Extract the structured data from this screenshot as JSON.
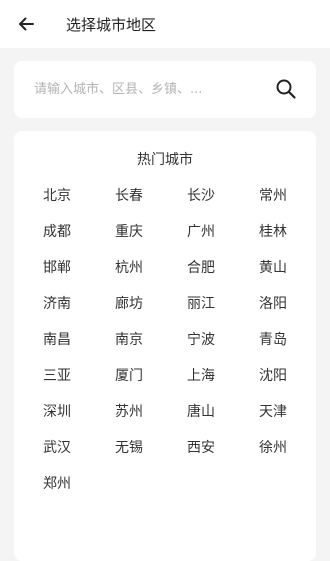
{
  "header": {
    "title": "选择城市地区"
  },
  "search": {
    "placeholder": "请输入城市、区县、乡镇、..."
  },
  "hot_cities": {
    "title": "热门城市",
    "cities": [
      "北京",
      "长春",
      "长沙",
      "常州",
      "成都",
      "重庆",
      "广州",
      "桂林",
      "邯郸",
      "杭州",
      "合肥",
      "黄山",
      "济南",
      "廊坊",
      "丽江",
      "洛阳",
      "南昌",
      "南京",
      "宁波",
      "青岛",
      "三亚",
      "厦门",
      "上海",
      "沈阳",
      "深圳",
      "苏州",
      "唐山",
      "天津",
      "武汉",
      "无锡",
      "西安",
      "徐州",
      "郑州"
    ]
  }
}
